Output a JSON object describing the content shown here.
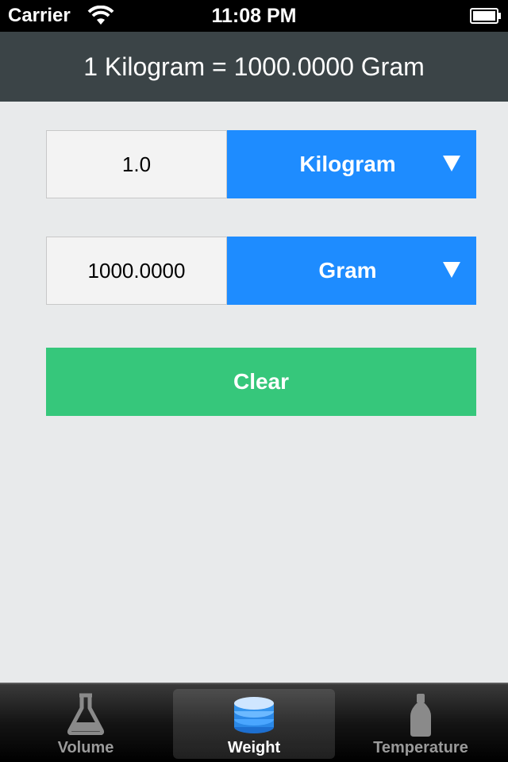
{
  "status_bar": {
    "carrier": "Carrier",
    "time": "11:08 PM"
  },
  "header": {
    "title": "1 Kilogram = 1000.0000 Gram"
  },
  "converter": {
    "from": {
      "value": "1.0",
      "unit": "Kilogram"
    },
    "to": {
      "value": "1000.0000",
      "unit": "Gram"
    },
    "clear_label": "Clear"
  },
  "tab_bar": {
    "tabs": [
      {
        "label": "Volume",
        "icon": "flask-icon",
        "selected": false
      },
      {
        "label": "Weight",
        "icon": "weight-stack-icon",
        "selected": true
      },
      {
        "label": "Temperature",
        "icon": "bottle-icon",
        "selected": false
      }
    ]
  },
  "colors": {
    "accent_blue": "#1e8cff",
    "clear_green": "#36c77b",
    "header_bg": "#3b4447",
    "background": "#e8eaeb"
  }
}
